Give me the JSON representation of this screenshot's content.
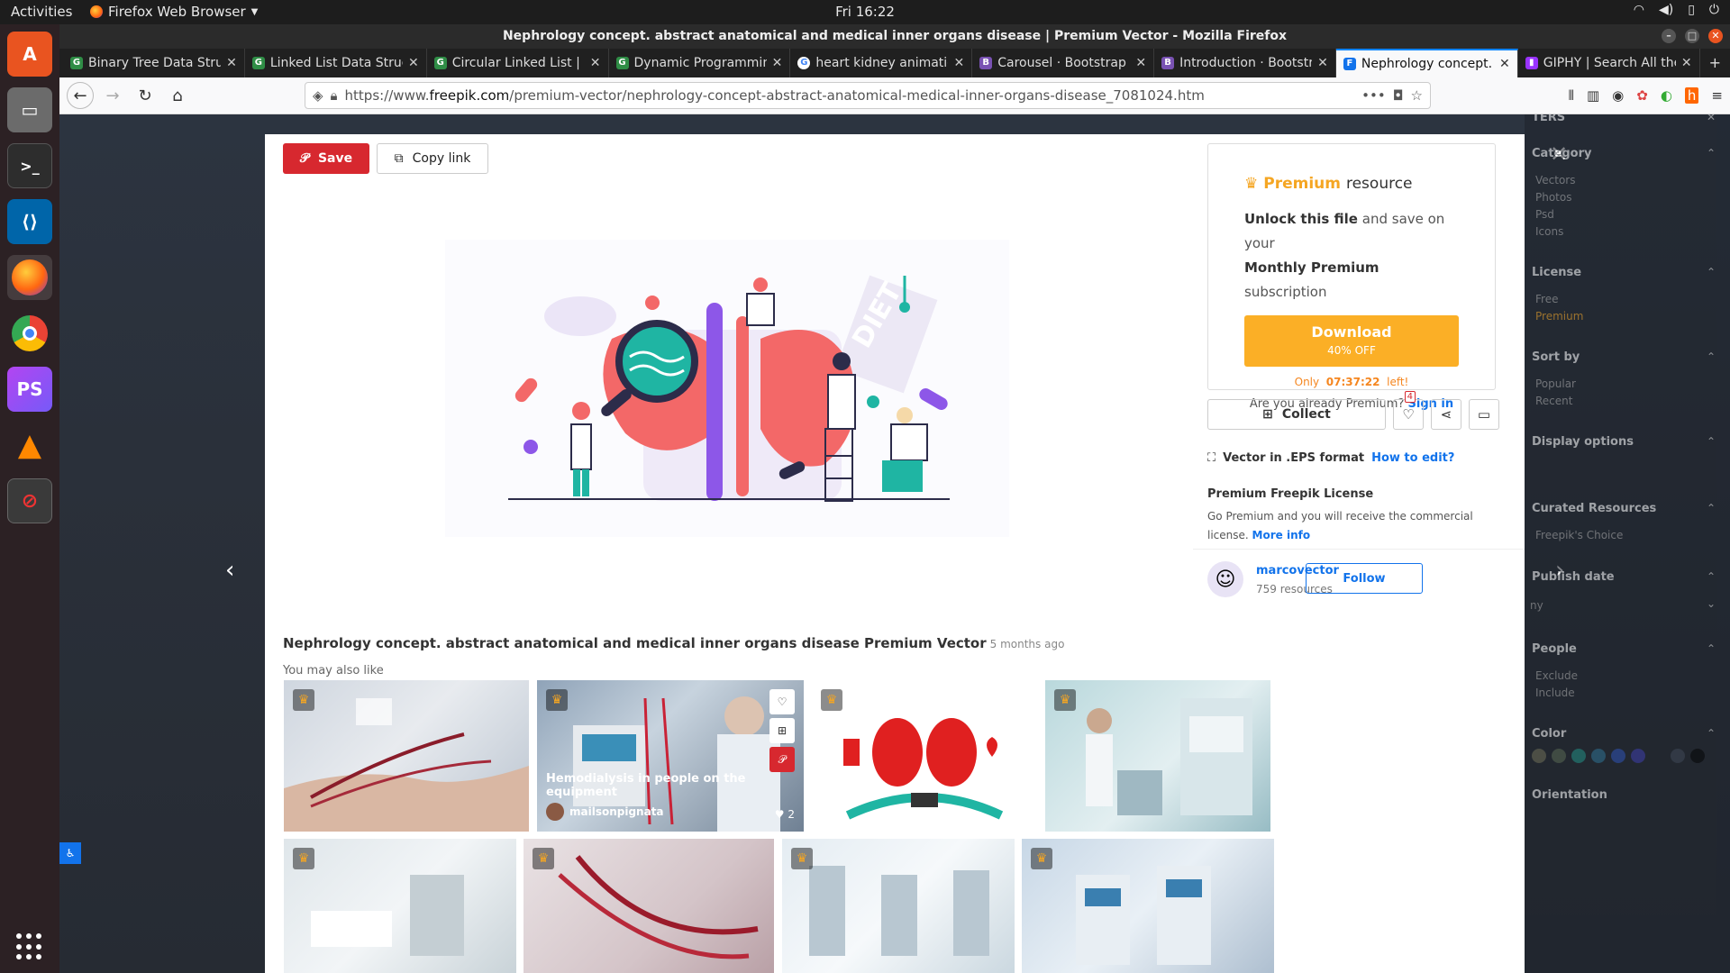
{
  "topbar": {
    "activities": "Activities",
    "app_name": "Firefox Web Browser",
    "clock": "Fri 16:22",
    "tray": [
      "wifi-icon",
      "volume-icon",
      "battery-icon",
      "power-icon"
    ]
  },
  "dock": {
    "apps": [
      "software-center",
      "files",
      "terminal",
      "vscode",
      "firefox",
      "chrome",
      "phpstorm",
      "vlc",
      "disabled-app"
    ]
  },
  "window": {
    "title": "Nephrology concept. abstract anatomical and medical inner organs disease | Premium Vector - Mozilla Firefox"
  },
  "tabs": [
    {
      "label": "Binary Tree Data Stru",
      "icon": "gfg",
      "color": "#2f8d46"
    },
    {
      "label": "Linked List Data Struc",
      "icon": "gfg",
      "color": "#2f8d46"
    },
    {
      "label": "Circular Linked List | S",
      "icon": "gfg",
      "color": "#2f8d46"
    },
    {
      "label": "Dynamic Programmin",
      "icon": "gfg",
      "color": "#2f8d46"
    },
    {
      "label": "heart kidney animatio",
      "icon": "G",
      "color": "#4285f4"
    },
    {
      "label": "Carousel · Bootstrap",
      "icon": "B",
      "color": "#7952b3"
    },
    {
      "label": "Introduction · Bootstr",
      "icon": "B",
      "color": "#7952b3"
    },
    {
      "label": "Nephrology concept.",
      "icon": "F",
      "color": "#1273eb",
      "active": true
    },
    {
      "label": "GIPHY | Search All the",
      "icon": "▮",
      "color": "#9933ff"
    }
  ],
  "url": {
    "prefix": "https://www.",
    "host": "freepik.com",
    "path": "/premium-vector/nephrology-concept-abstract-anatomical-medical-inner-organs-disease_7081024.htm"
  },
  "modal": {
    "save": "Save",
    "copy_link": "Copy link",
    "premium_word": "Premium",
    "resource_word": "resource",
    "unlock_bold": "Unlock this file",
    "unlock_rest": "and save on your",
    "monthly_bold": "Monthly Premium",
    "monthly_rest": "subscription",
    "download": "Download",
    "discount": "40% OFF",
    "only": "Only",
    "timer": "07:37:22",
    "left": "left!",
    "already": "Are you already Premium?",
    "sign_in": "Sign in",
    "collect": "Collect",
    "likes_badge": "4",
    "format": "Vector in .EPS format",
    "how_to_edit": "How to edit?",
    "license_title": "Premium Freepik License",
    "license_desc": "Go Premium and you will receive the commercial license.",
    "more_info": "More info",
    "author_name": "marcovector",
    "author_resources": "759 resources",
    "follow": "Follow",
    "image_title": "Nephrology concept. abstract anatomical and medical inner organs disease Premium Vector",
    "ago": "5 months ago",
    "also_like": "You may also like",
    "thumb2_caption": "Hemodialysis in people on the equipment",
    "thumb2_author": "mailsonpignata",
    "thumb2_likes": "2"
  },
  "filters": {
    "title": "TERS",
    "category": "Category",
    "category_items": [
      "Vectors",
      "Photos",
      "Psd",
      "Icons"
    ],
    "license": "License",
    "license_items": [
      "Free",
      "Premium"
    ],
    "sort_by": "Sort by",
    "sort_items": [
      "Popular",
      "Recent"
    ],
    "display": "Display options",
    "curated": "Curated Resources",
    "curated_item": "Freepik's Choice",
    "publish": "Publish date",
    "publish_value": "ny",
    "people": "People",
    "people_items": [
      "Exclude",
      "Include"
    ],
    "color": "Color",
    "orientation": "Orientation",
    "colors": [
      "#3a3a2e",
      "#2f3a2e",
      "#1e5a54",
      "#1e4a6a",
      "#1a3a8a",
      "#2a2a8a",
      "#1e232b",
      "#2a3040",
      "#111111"
    ]
  }
}
